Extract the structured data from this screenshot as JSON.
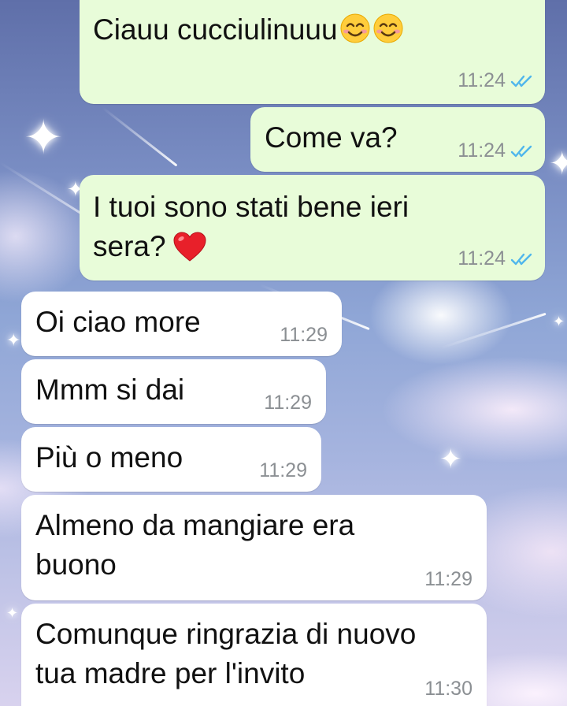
{
  "chat": {
    "messages": [
      {
        "direction": "outgoing",
        "text": "Ciauu cucciulinuuu",
        "emoji": [
          "smiling-face-icon",
          "smiling-face-icon"
        ],
        "time": "11:24",
        "status": "read"
      },
      {
        "direction": "outgoing",
        "text": "Come va?",
        "time": "11:24",
        "status": "read"
      },
      {
        "direction": "outgoing",
        "lines": [
          "I tuoi sono stati bene ieri",
          "sera?"
        ],
        "emoji": [
          "red-heart-icon"
        ],
        "time": "11:24",
        "status": "read"
      },
      {
        "direction": "incoming",
        "text": "Oi ciao more",
        "time": "11:29"
      },
      {
        "direction": "incoming",
        "text": "Mmm si dai",
        "time": "11:29"
      },
      {
        "direction": "incoming",
        "text": "Più o meno",
        "time": "11:29"
      },
      {
        "direction": "incoming",
        "lines": [
          "Almeno da mangiare era",
          "buono"
        ],
        "time": "11:29"
      },
      {
        "direction": "incoming",
        "lines": [
          "Comunque ringrazia di nuovo",
          "tua madre per l'invito"
        ],
        "time": "11:30"
      }
    ]
  },
  "colors": {
    "outgoing_bubble": "#e8fcd9",
    "incoming_bubble": "#ffffff",
    "read_ticks": "#4fb6ec",
    "timestamp": "#8b8f93"
  }
}
